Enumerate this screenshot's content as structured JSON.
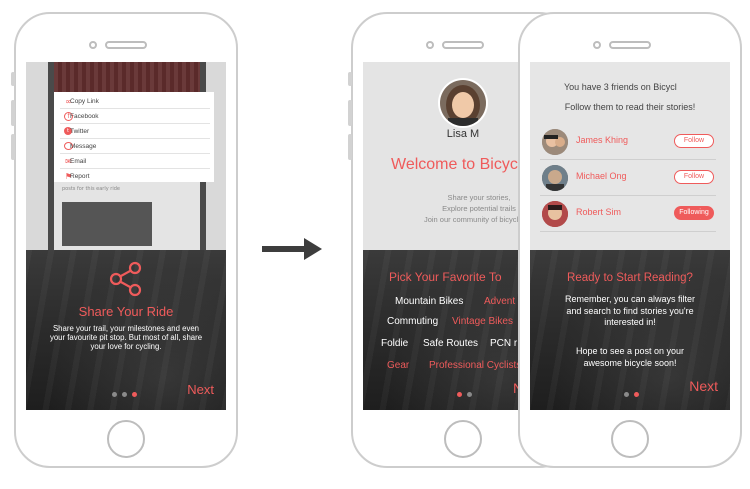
{
  "phone1": {
    "share_menu": [
      {
        "label": "Copy Link",
        "icon": "link-icon"
      },
      {
        "label": "Facebook",
        "icon": "facebook-icon"
      },
      {
        "label": "Twitter",
        "icon": "twitter-icon"
      },
      {
        "label": "Message",
        "icon": "message-icon"
      },
      {
        "label": "Email",
        "icon": "email-icon"
      },
      {
        "label": "Report",
        "icon": "flag-icon"
      }
    ],
    "behind_text": "posts for this early ride",
    "title": "Share Your Ride",
    "body": "Share your trail, your milestones and even your favourite pit stop. But most of all, share your love for cycling.",
    "next": "Next",
    "pages": 3,
    "active_page": 3
  },
  "arrow_icon": "right-arrow-icon",
  "phone2": {
    "user_name": "Lisa M",
    "welcome": "Welcome to Bicycl",
    "intro_lines": [
      "Share your stories,",
      "Explore potential trails",
      "Join our community of bicycle lov"
    ],
    "pick_title": "Pick Your Favorite To",
    "tags": [
      {
        "label": "Mountain Bikes",
        "selected": false
      },
      {
        "label": "Advent",
        "selected": true
      },
      {
        "label": "Commuting",
        "selected": false
      },
      {
        "label": "Vintage Bikes",
        "selected": true
      },
      {
        "label": "Foldie",
        "selected": false
      },
      {
        "label": "Safe Routes",
        "selected": false
      },
      {
        "label": "PCN r",
        "selected": false
      },
      {
        "label": "Gear",
        "selected": true
      },
      {
        "label": "Professional Cyclists",
        "selected": true
      }
    ],
    "next": "N",
    "pages": 2,
    "active_page": 1
  },
  "phone3": {
    "friends_line": "You have 3 friends on Bicycl",
    "follow_line": "Follow them to read their stories!",
    "friends": [
      {
        "name": "James Khing",
        "button": "Follow",
        "following": false
      },
      {
        "name": "Michael Ong",
        "button": "Follow",
        "following": false
      },
      {
        "name": "Robert Sim",
        "button": "Following",
        "following": true
      }
    ],
    "ready_title": "Ready to Start Reading?",
    "ready_body": "Remember, you can always filter and search to find stories you're interested in!",
    "hope_body": "Hope to see a post on your awesome bicycle soon!",
    "next": "Next",
    "pages": 2,
    "active_page": 2
  },
  "colors": {
    "accent": "#ef5b5b",
    "dark": "#2b2b2b"
  }
}
